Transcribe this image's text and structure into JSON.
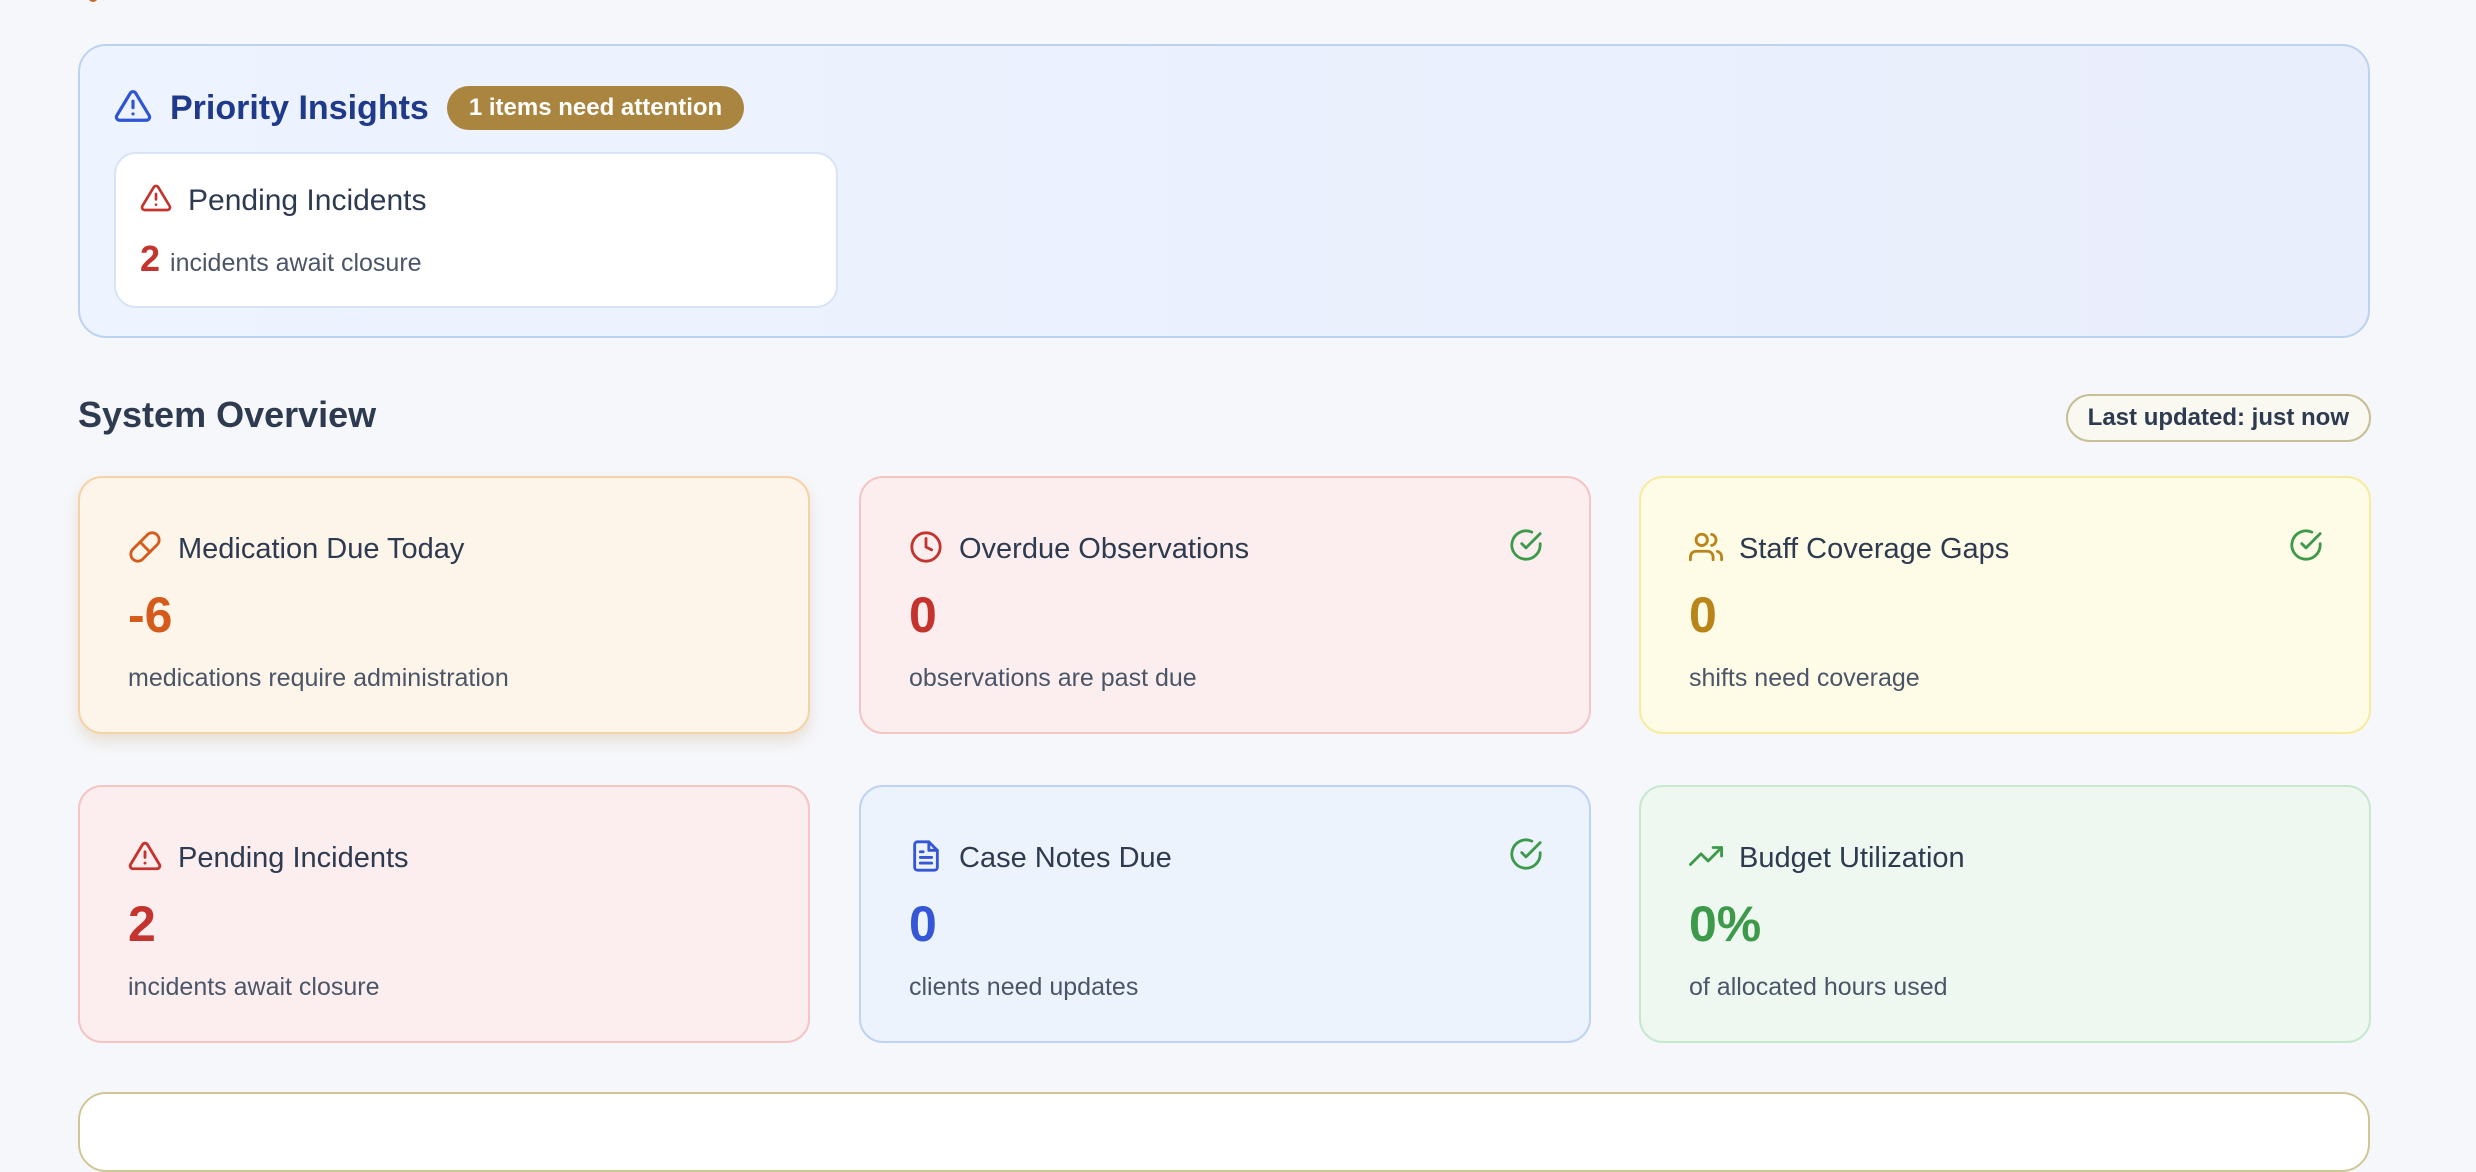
{
  "priority_insights": {
    "title": "Priority Insights",
    "badge": "1 items need attention",
    "items": [
      {
        "icon": "alert-triangle-icon",
        "label": "Pending Incidents",
        "value": "2",
        "description": "incidents await closure"
      }
    ]
  },
  "overview": {
    "title": "System Overview",
    "last_updated": "Last updated: just now",
    "cards": [
      {
        "icon": "pill-icon",
        "label": "Medication Due Today",
        "value": "-6",
        "description": "medications require administration",
        "status": "",
        "color": "#d55b1d"
      },
      {
        "icon": "clock-icon",
        "label": "Overdue Observations",
        "value": "0",
        "description": "observations are past due",
        "status": "check-circle-icon",
        "color": "#c4332d"
      },
      {
        "icon": "users-icon",
        "label": "Staff Coverage Gaps",
        "value": "0",
        "description": "shifts need coverage",
        "status": "check-circle-icon",
        "color": "#b98418"
      },
      {
        "icon": "alert-triangle-icon",
        "label": "Pending Incidents",
        "value": "2",
        "description": "incidents await closure",
        "status": "",
        "color": "#c4332d"
      },
      {
        "icon": "file-text-icon",
        "label": "Case Notes Due",
        "value": "0",
        "description": "clients need updates",
        "status": "check-circle-icon",
        "color": "#3556d6"
      },
      {
        "icon": "trending-up-icon",
        "label": "Budget Utilization",
        "value": "0%",
        "description": "of allocated hours used",
        "status": "",
        "color": "#3d9a4a"
      }
    ]
  }
}
